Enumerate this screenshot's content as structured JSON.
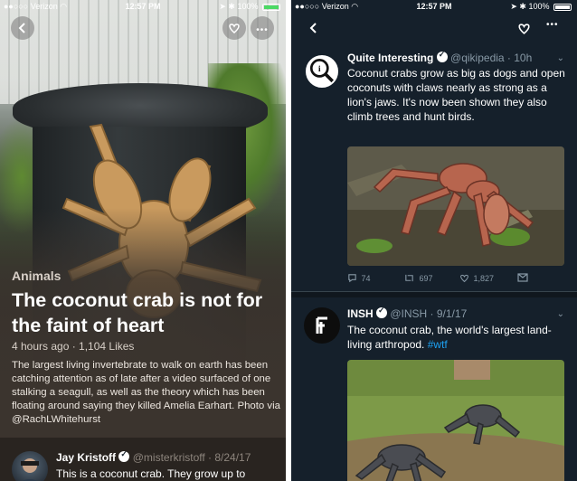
{
  "left": {
    "status": {
      "carrier": "Verizon",
      "time": "12:57 PM",
      "battery": "100%"
    },
    "category": "Animals",
    "headline": "The coconut crab is not for the faint of heart",
    "meta": "4 hours ago · 1,104 Likes",
    "summary": "The largest living invertebrate to walk on earth has been catching attention as of late after a video surfaced of one stalking a seagull, as well as the theory which has been floating around saying they killed Amelia Earhart.  Photo via @RachLWhitehurst",
    "tweet": {
      "name": "Jay Kristoff",
      "handle_time": "@misterkristoff · 8/24/17",
      "text": "This is a coconut crab. They grow up to"
    }
  },
  "right": {
    "status": {
      "carrier": "Verizon",
      "time": "12:57 PM",
      "battery": "100%"
    },
    "tweets": [
      {
        "name": "Quite Interesting",
        "handle_time": "@qikipedia · 10h",
        "text": "Coconut crabs grow as big as dogs and open coconuts with claws nearly as strong as a lion's jaws. It's now been shown they also climb trees and hunt birds.",
        "replies": "74",
        "retweets": "697",
        "likes": "1,827"
      },
      {
        "name": "INSH",
        "handle_time": "@INSH · 9/1/17",
        "text": "The coconut crab, the world's largest land-living arthropod.",
        "hashtag": "#wtf"
      }
    ]
  },
  "colors": {
    "left_bg": "#3b342e",
    "twitter_bg": "#15202b",
    "twitter_link": "#1da1f2",
    "twitter_muted": "#8899a6"
  }
}
